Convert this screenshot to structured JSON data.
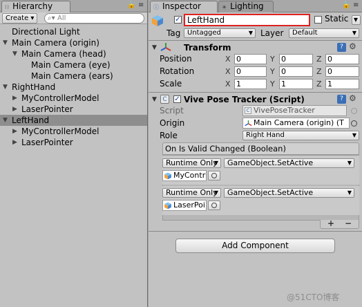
{
  "hierarchy": {
    "tab_title": "Hierarchy",
    "create_label": "Create",
    "search_placeholder": "All",
    "items": [
      {
        "label": "Directional Light",
        "arrow": ""
      },
      {
        "label": "Main Camera (origin)",
        "arrow": "▼"
      },
      {
        "label": "Main Camera (head)",
        "arrow": "▼"
      },
      {
        "label": "Main Camera (eye)",
        "arrow": ""
      },
      {
        "label": "Main Camera (ears)",
        "arrow": ""
      },
      {
        "label": "RightHand",
        "arrow": "▼"
      },
      {
        "label": "MyControllerModel",
        "arrow": "▶"
      },
      {
        "label": "LaserPointer",
        "arrow": "▶"
      },
      {
        "label": "LeftHand",
        "arrow": "▼"
      },
      {
        "label": "MyControllerModel",
        "arrow": "▶"
      },
      {
        "label": "LaserPointer",
        "arrow": "▶"
      }
    ]
  },
  "inspector": {
    "tab_title": "Inspector",
    "lighting_tab": "Lighting",
    "object_name": "LeftHand",
    "static_label": "Static",
    "tag_label": "Tag",
    "tag_value": "Untagged",
    "layer_label": "Layer",
    "layer_value": "Default",
    "transform": {
      "title": "Transform",
      "rows": [
        {
          "label": "Position",
          "x": "0",
          "y": "0",
          "z": "0"
        },
        {
          "label": "Rotation",
          "x": "0",
          "y": "0",
          "z": "0"
        },
        {
          "label": "Scale",
          "x": "1",
          "y": "1",
          "z": "1"
        }
      ],
      "axis_x": "X",
      "axis_y": "Y",
      "axis_z": "Z"
    },
    "tracker": {
      "title": "Vive Pose Tracker (Script)",
      "script_label": "Script",
      "script_value": "VivePoseTracker",
      "origin_label": "Origin",
      "origin_value": "Main Camera (origin) (T",
      "role_label": "Role",
      "role_value": "Right Hand",
      "event_title": "On Is Valid Changed (Boolean)",
      "entries": [
        {
          "mode": "Runtime Only",
          "function": "GameObject.SetActive",
          "target": "MyContr"
        },
        {
          "mode": "Runtime Only",
          "function": "GameObject.SetActive",
          "target": "LaserPoi"
        }
      ],
      "plus": "+",
      "minus": "−"
    },
    "add_component": "Add Component"
  },
  "watermark": "@51CTO博客"
}
